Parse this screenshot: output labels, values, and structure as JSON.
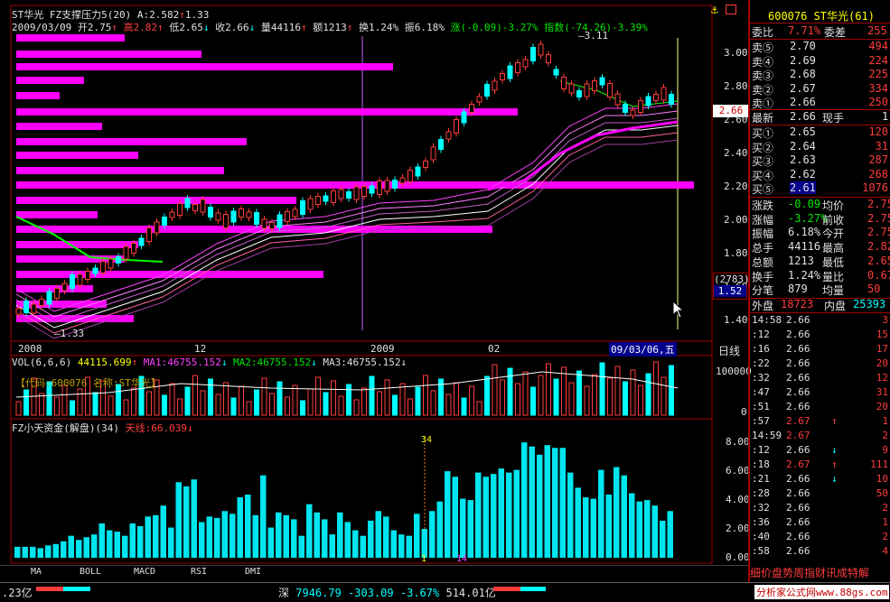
{
  "header": {
    "stock_name": "ST华光",
    "indicator": "FZ支撑压力5(20)",
    "a_value": "A:2.582",
    "a_arrow": "↑",
    "a_change": "1.33",
    "info_date": "2009/03/09",
    "open": "开2.75",
    "open_arrow": "↑",
    "high": "高2.82",
    "high_arrow": "↑",
    "low": "低2.65",
    "low_arrow": "↓",
    "close": "收2.66",
    "close_arrow": "↓",
    "volume": "量44116",
    "volume_arrow": "↑",
    "amount": "额1213",
    "amount_arrow": "↑",
    "turnover": "换1.24%",
    "amplitude": "振6.18%",
    "change": "涨(-0.09)-3.27%",
    "index": "指数(-74.26)-3.39%"
  },
  "price_axis": [
    "3.00",
    "2.80",
    "2.60",
    "2.40",
    "2.20",
    "2.00",
    "1.80",
    "1.60",
    "1.40"
  ],
  "price_labels": {
    "high_label": "3.11",
    "low_label": "1.33",
    "current": "2.66",
    "box_top": "(2783)",
    "box_bottom": "1.52"
  },
  "time_axis": {
    "labels": [
      "2008",
      "12",
      "2009",
      "02"
    ],
    "cursor_date": "09/03/06,五",
    "period": "日线"
  },
  "volume_panel": {
    "title": "VOL(6,6,6)",
    "value": "44115.699",
    "ma1": "MA1:46755.152",
    "ma2": "MA2:46755.152",
    "ma3": "MA3:46755.152",
    "code_label": "【代码:600076 名称:ST华光】",
    "axis": [
      "100000",
      "0"
    ]
  },
  "fund_panel": {
    "title": "FZ小天资金(解盘)(34)",
    "line_label": "天线:66.039",
    "marker": "34",
    "bottom_marks": [
      "1",
      "14"
    ],
    "axis": [
      "8.00",
      "6.00",
      "4.00",
      "2.00",
      "0.00"
    ]
  },
  "tabs": [
    "MA",
    "BOLL",
    "MACD",
    "RSI",
    "DMI"
  ],
  "status_bar": {
    "left_value": ".23亿",
    "market": "深",
    "index": "7946.79",
    "change": "-303.09",
    "pct": "-3.67%",
    "amount": "514.01亿",
    "watermark": "分析家公式网www.88gs.com"
  },
  "quote_panel": {
    "title": "600076 ST华光(61)",
    "webi_label": "委比",
    "webi_value": "7.71%",
    "weicha_label": "委差",
    "weicha_value": "255",
    "sells": [
      {
        "label": "卖⑤",
        "price": "2.70",
        "vol": "494"
      },
      {
        "label": "卖④",
        "price": "2.69",
        "vol": "224"
      },
      {
        "label": "卖③",
        "price": "2.68",
        "vol": "225"
      },
      {
        "label": "卖②",
        "price": "2.67",
        "vol": "334"
      },
      {
        "label": "卖①",
        "price": "2.66",
        "vol": "250"
      }
    ],
    "latest_label": "最新",
    "latest_value": "2.66",
    "now_label": "现手",
    "now_value": "1",
    "buys": [
      {
        "label": "买①",
        "price": "2.65",
        "vol": "120"
      },
      {
        "label": "买②",
        "price": "2.64",
        "vol": "31"
      },
      {
        "label": "买③",
        "price": "2.63",
        "vol": "287"
      },
      {
        "label": "买④",
        "price": "2.62",
        "vol": "268"
      },
      {
        "label": "买⑤",
        "price": "2.61",
        "vol": "1076"
      }
    ],
    "stats": [
      {
        "l1": "涨跌",
        "v1": "-0.09",
        "l2": "均价",
        "v2": "2.75"
      },
      {
        "l1": "涨幅",
        "v1": "-3.27%",
        "l2": "前收",
        "v2": "2.75"
      },
      {
        "l1": "振幅",
        "v1": "6.18%",
        "l2": "今开",
        "v2": "2.75"
      },
      {
        "l1": "总手",
        "v1": "44116",
        "l2": "最高",
        "v2": "2.82"
      },
      {
        "l1": "总额",
        "v1": "1213",
        "l2": "最低",
        "v2": "2.65"
      },
      {
        "l1": "换手",
        "v1": "1.24%",
        "l2": "量比",
        "v2": "0.67"
      },
      {
        "l1": "分笔",
        "v1": "879",
        "l2": "均量",
        "v2": "50"
      }
    ],
    "outer_label": "外盘",
    "outer_value": "18723",
    "inner_label": "内盘",
    "inner_value": "25393"
  },
  "ticks": [
    {
      "t": "14:58",
      "p": "2.66",
      "a": "",
      "v": "3"
    },
    {
      "t": ":12",
      "p": "2.66",
      "a": "",
      "v": "15"
    },
    {
      "t": ":16",
      "p": "2.66",
      "a": "",
      "v": "17"
    },
    {
      "t": ":22",
      "p": "2.66",
      "a": "",
      "v": "20"
    },
    {
      "t": ":32",
      "p": "2.66",
      "a": "",
      "v": "12"
    },
    {
      "t": ":47",
      "p": "2.66",
      "a": "",
      "v": "31"
    },
    {
      "t": ":51",
      "p": "2.66",
      "a": "",
      "v": "20"
    },
    {
      "t": ":57",
      "p": "2.67",
      "a": "↑",
      "v": "1"
    },
    {
      "t": "14:59",
      "p": "2.67",
      "a": "",
      "v": "2"
    },
    {
      "t": ":12",
      "p": "2.66",
      "a": "↓",
      "v": "9"
    },
    {
      "t": ":18",
      "p": "2.67",
      "a": "↑",
      "v": "111"
    },
    {
      "t": ":21",
      "p": "2.66",
      "a": "↓",
      "v": "10"
    },
    {
      "t": ":28",
      "p": "2.66",
      "a": "",
      "v": "50"
    },
    {
      "t": ":32",
      "p": "2.66",
      "a": "",
      "v": "2"
    },
    {
      "t": ":36",
      "p": "2.66",
      "a": "",
      "v": "1"
    },
    {
      "t": ":40",
      "p": "2.66",
      "a": "",
      "v": "2"
    },
    {
      "t": ":58",
      "p": "2.66",
      "a": "",
      "v": "4"
    }
  ],
  "bottom_right_tabs": "细价盘势周指财讯成特解",
  "colors": {
    "up": "#ff3c3c",
    "down": "#00ffff",
    "support": "#ff00ff",
    "ma_green": "#00ff00"
  },
  "chart_data": {
    "type": "bar",
    "title": "FZ小天资金(解盘)",
    "values": [
      0.8,
      0.8,
      0.8,
      0.7,
      0.9,
      1.0,
      1.2,
      1.6,
      1.3,
      1.5,
      1.7,
      2.5,
      2.0,
      1.9,
      1.6,
      2.5,
      2.3,
      3.0,
      3.1,
      3.8,
      2.2,
      5.5,
      5.2,
      5.7,
      2.6,
      3.0,
      2.9,
      3.4,
      3.2,
      4.4,
      4.6,
      3.1,
      6.0,
      2.2,
      3.3,
      3.1,
      2.8,
      1.6,
      3.9,
      3.3,
      2.8,
      1.7,
      3.3,
      2.6,
      2.0,
      1.6,
      2.7,
      3.4,
      3.0,
      2.0,
      1.7,
      1.6,
      3.2,
      2.1,
      3.4,
      4.1,
      6.3,
      5.9,
      4.3,
      4.2,
      6.2,
      5.9,
      6.1,
      6.5,
      6.2,
      6.4,
      8.4,
      8.1,
      7.5,
      8.2,
      8.0,
      8.0,
      6.2,
      5.1,
      4.4,
      4.3,
      6.4,
      4.6,
      6.6,
      6.0,
      4.7,
      4.1,
      4.2,
      3.8,
      2.7,
      3.4
    ],
    "ylim": [
      0,
      9
    ]
  }
}
